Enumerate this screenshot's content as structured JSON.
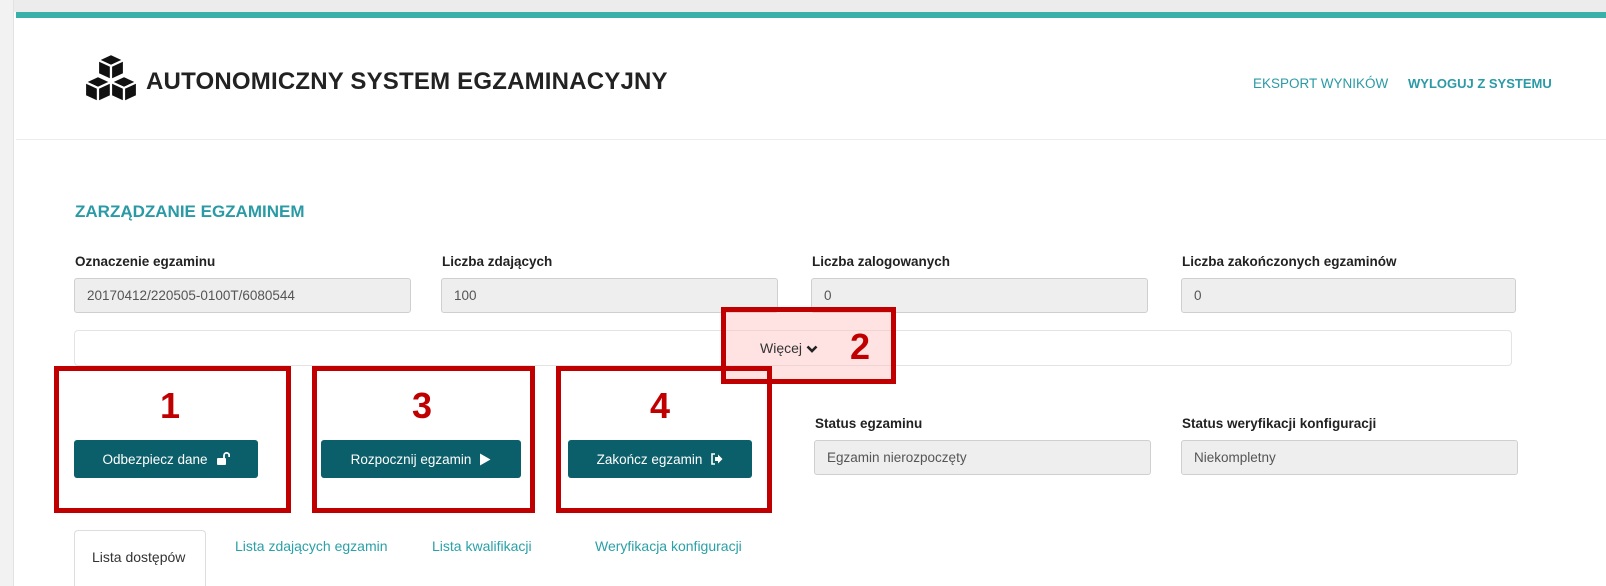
{
  "header": {
    "app_title": "AUTONOMICZNY SYSTEM EGZAMINACYJNY",
    "logo_icon": "cubes-icon",
    "nav": {
      "export_label": "EKSPORT WYNIKÓW",
      "logout_label": "WYLOGUJ Z SYSTEMU"
    },
    "accent_color": "#3ab0ab"
  },
  "section": {
    "title": "ZARZĄDZANIE EGZAMINEM"
  },
  "fields": {
    "exam_id": {
      "label": "Oznaczenie egzaminu",
      "value": "20170412/220505-0100T/6080544"
    },
    "candidates": {
      "label": "Liczba zdających",
      "value": "100"
    },
    "logged_in": {
      "label": "Liczba zalogowanych",
      "value": "0"
    },
    "finished": {
      "label": "Liczba zakończonych egzaminów",
      "value": "0"
    },
    "exam_status": {
      "label": "Status egzaminu",
      "value": "Egzamin nierozpoczęty"
    },
    "config_status": {
      "label": "Status weryfikacji konfiguracji",
      "value": "Niekompletny"
    }
  },
  "more": {
    "label": "Więcej",
    "icon": "chevron-down-icon"
  },
  "buttons": {
    "unlock": {
      "label": "Odbezpiecz dane",
      "icon": "unlock-icon"
    },
    "start": {
      "label": "Rozpocznij egzamin",
      "icon": "play-icon"
    },
    "finish": {
      "label": "Zakończ egzamin",
      "icon": "sign-out-icon"
    },
    "color": "#0b5f6a"
  },
  "annotations": {
    "box1": "1",
    "box2": "2",
    "box3": "3",
    "box4": "4",
    "color": "#c00000"
  },
  "tabs": [
    {
      "label": "Lista dostępów",
      "active": true
    },
    {
      "label": "Lista zdających egzamin",
      "active": false
    },
    {
      "label": "Lista kwalifikacji",
      "active": false
    },
    {
      "label": "Weryfikacja konfiguracji",
      "active": false
    }
  ]
}
